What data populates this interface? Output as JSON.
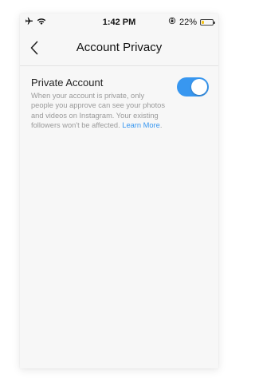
{
  "status_bar": {
    "time": "1:42 PM",
    "battery_percent": "22%",
    "battery_level": 0.22,
    "battery_color": "#f2c219",
    "icons": [
      "airplane-icon",
      "wifi-icon",
      "orientation-lock-icon",
      "battery-icon"
    ]
  },
  "nav": {
    "title": "Account Privacy",
    "back_icon": "chevron-left-icon"
  },
  "setting": {
    "title": "Private Account",
    "description": "When your account is private, only people you approve can see your photos and videos on Instagram. Your existing followers won't be affected.",
    "link_text": "Learn More",
    "link_suffix": ".",
    "toggle_on": true,
    "toggle_color": "#3897f0"
  },
  "colors": {
    "accent": "#3897f0",
    "background": "#f7f7f7",
    "secondary_text": "#9a9a9a"
  }
}
